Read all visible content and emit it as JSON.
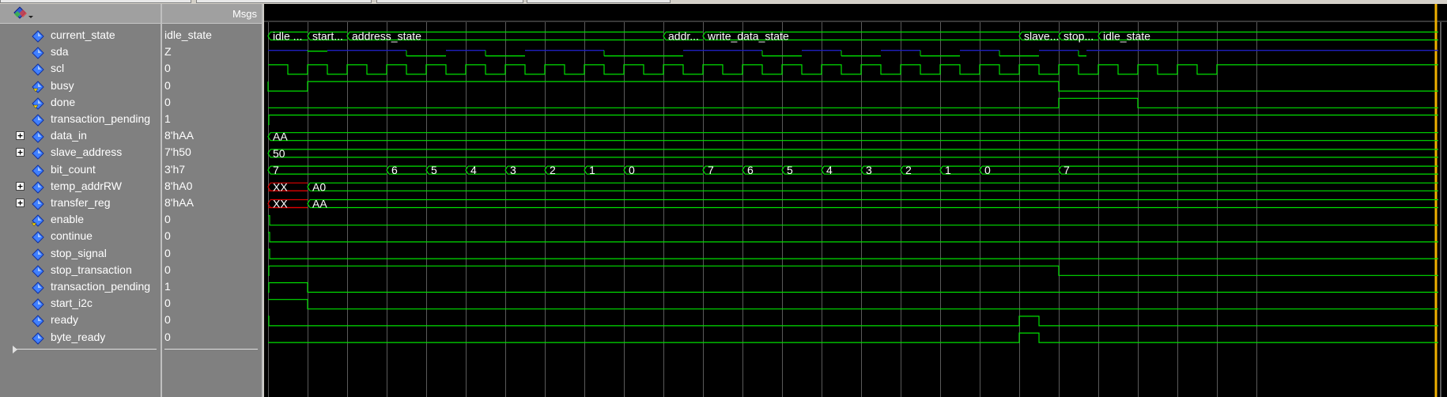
{
  "header": {
    "msgs_label": "Msgs"
  },
  "signals": [
    {
      "name": "current_state",
      "value": "idle_state",
      "icon": "diamond-icon",
      "expandable": false
    },
    {
      "name": "sda",
      "value": "Z",
      "icon": "diamond-icon",
      "expandable": false
    },
    {
      "name": "scl",
      "value": "0",
      "icon": "diamond-icon",
      "expandable": false
    },
    {
      "name": "busy",
      "value": "0",
      "icon": "diamond-output-icon",
      "expandable": false
    },
    {
      "name": "done",
      "value": "0",
      "icon": "diamond-output-icon",
      "expandable": false
    },
    {
      "name": "transaction_pending",
      "value": "1",
      "icon": "diamond-icon",
      "expandable": false
    },
    {
      "name": "data_in",
      "value": "8'hAA",
      "icon": "diamond-icon",
      "expandable": true
    },
    {
      "name": "slave_address",
      "value": "7'h50",
      "icon": "diamond-icon",
      "expandable": true
    },
    {
      "name": "bit_count",
      "value": "3'h7",
      "icon": "diamond-icon",
      "expandable": false
    },
    {
      "name": "temp_addrRW",
      "value": "8'hA0",
      "icon": "diamond-icon",
      "expandable": true
    },
    {
      "name": "transfer_reg",
      "value": "8'hAA",
      "icon": "diamond-icon",
      "expandable": true
    },
    {
      "name": "enable",
      "value": "0",
      "icon": "diamond-input-icon",
      "expandable": false
    },
    {
      "name": "continue",
      "value": "0",
      "icon": "diamond-icon",
      "expandable": false
    },
    {
      "name": "stop_signal",
      "value": "0",
      "icon": "diamond-icon",
      "expandable": false
    },
    {
      "name": "stop_transaction",
      "value": "0",
      "icon": "diamond-icon",
      "expandable": false
    },
    {
      "name": "transaction_pending",
      "value": "1",
      "icon": "diamond-icon",
      "expandable": false
    },
    {
      "name": "start_i2c",
      "value": "0",
      "icon": "diamond-icon",
      "expandable": false
    },
    {
      "name": "ready",
      "value": "0",
      "icon": "diamond-icon",
      "expandable": false
    },
    {
      "name": "byte_ready",
      "value": "0",
      "icon": "diamond-icon",
      "expandable": false
    }
  ],
  "waves": {
    "current_state": [
      "idle ...",
      "start...",
      "address_state",
      "addr...",
      "write_data_state",
      "slave...",
      "stop...",
      "idle_state"
    ],
    "data_in": [
      "AA"
    ],
    "slave_address": [
      "50"
    ],
    "bit_count": [
      "7",
      "6",
      "5",
      "4",
      "3",
      "2",
      "1",
      "0",
      "7",
      "6",
      "5",
      "4",
      "3",
      "2",
      "1",
      "0",
      "7"
    ],
    "temp_addrRW": [
      "XX",
      "A0"
    ],
    "transfer_reg": [
      "XX",
      "AA"
    ]
  },
  "colors": {
    "wave": "#00e000",
    "highz": "#2020c0",
    "unknown": "#e00000",
    "cursor": "#f0b000",
    "grid": "#5a5a5a",
    "pane": "#808080"
  }
}
